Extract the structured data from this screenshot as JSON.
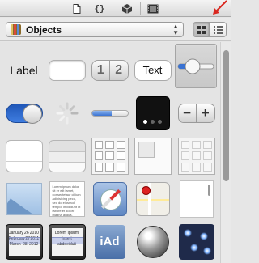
{
  "toolbar": {
    "icons": [
      "file-inspector-icon",
      "code-snippet-icon",
      "object-library-icon",
      "media-library-icon"
    ],
    "snippet_glyph": "{}"
  },
  "library_selector": {
    "selected": "Objects",
    "view_mode": "icon-grid"
  },
  "objects": {
    "label_text": "Label",
    "segment_1": "1",
    "segment_2": "2",
    "text_button": "Text",
    "text_view_lorem": "Lorem ipsum dolor sit er elit lamet, consectetaur cillium adipisicing pecu, sed do eiusmod tempor incididunt ut labore et dolore magna aliqua.",
    "picker_rows": [
      [
        "January",
        "26",
        "2010"
      ],
      [
        "February",
        "27",
        "2011"
      ],
      [
        "March",
        "28",
        "2012"
      ]
    ],
    "picker_generic_rows": [
      "Lorem Ipsum",
      "Insert",
      "abddeiduti"
    ],
    "iad_text": "iAd"
  },
  "colors": {
    "accent_blue": "#3a72d2",
    "annotation_arrow": "#d9271f"
  }
}
